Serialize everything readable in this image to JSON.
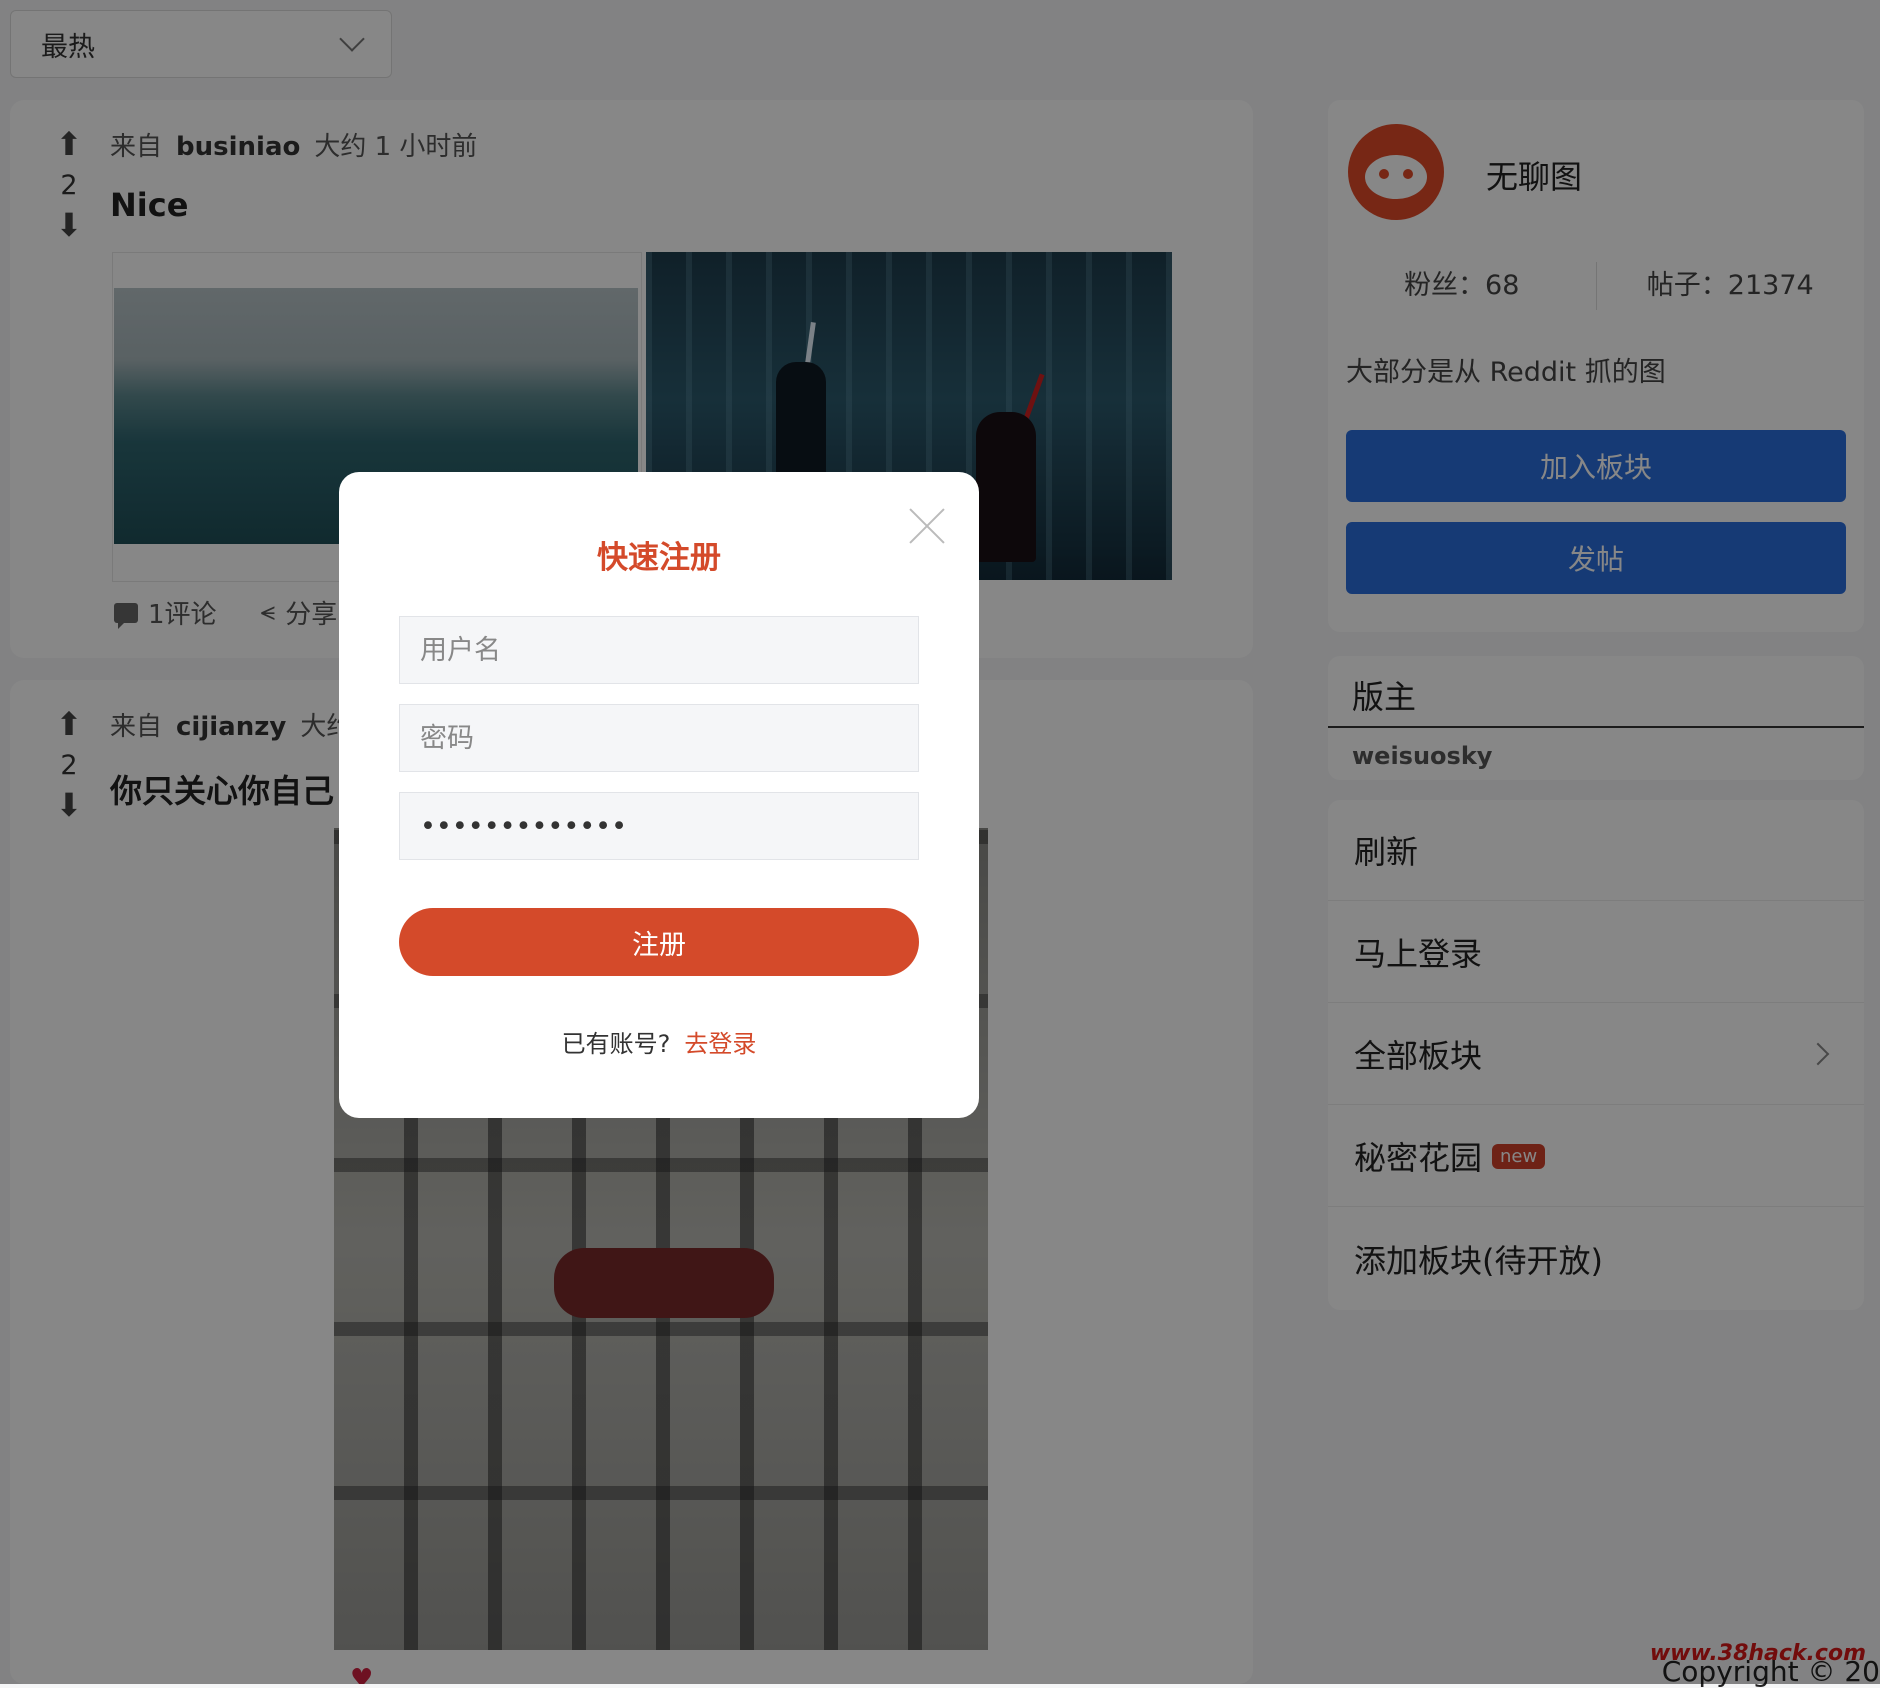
{
  "sort": {
    "selected": "最热"
  },
  "posts": [
    {
      "votes": "2",
      "from_label": "来自",
      "author": "businiao",
      "time": "大约 1 小时前",
      "title": "Nice",
      "comments": "1评论",
      "share": "分享"
    },
    {
      "votes": "2",
      "from_label": "来自",
      "author": "cijianzy",
      "time": "大约",
      "title": "你只关心你自己"
    }
  ],
  "board": {
    "name": "无聊图",
    "followers": "粉丝：68",
    "posts_count": "帖子：21374",
    "description": "大部分是从 Reddit 抓的图",
    "join_label": "加入板块",
    "post_label": "发帖"
  },
  "moderators": {
    "title": "版主",
    "user": "weisuosky"
  },
  "menu": {
    "refresh": "刷新",
    "login": "马上登录",
    "all_boards": "全部板块",
    "secret_garden": "秘密花园",
    "new_badge": "new",
    "add_board": "添加板块(待开放)"
  },
  "footer": {
    "copyright": "Copyright © 20",
    "watermark": "www.38hack.com"
  },
  "modal": {
    "title": "快速注册",
    "username_placeholder": "用户名",
    "password_placeholder": "密码",
    "password_value": "•••••••••••••",
    "register_label": "注册",
    "has_account": "已有账号?",
    "go_login": "去登录"
  },
  "icons": {
    "upvote": "arrow-up-icon",
    "downvote": "arrow-down-icon",
    "comment": "comment-icon",
    "share": "share-icon",
    "close": "close-icon",
    "dropdown": "chevron-down-icon",
    "menu_arrow": "chevron-right-icon"
  }
}
